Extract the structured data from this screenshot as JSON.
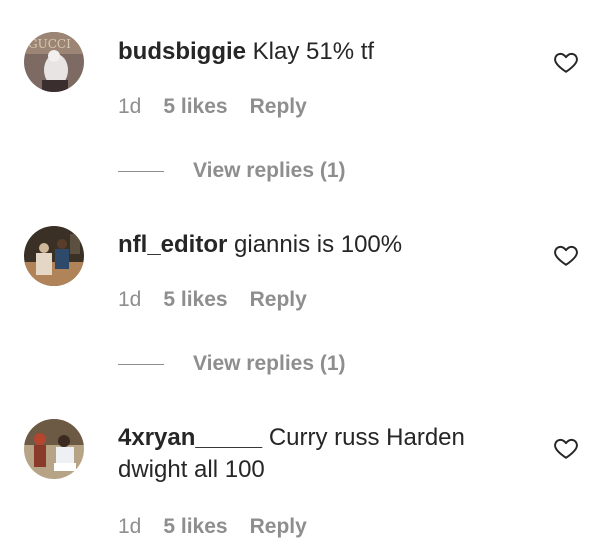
{
  "comments": [
    {
      "username": "budsbiggie",
      "text": "Klay 51% tf",
      "age": "1d",
      "likes": "5 likes",
      "reply": "Reply",
      "view_replies": "View replies (1)",
      "avatar_icon": "avatar-image",
      "like_icon": "heart-icon"
    },
    {
      "username": "nfl_editor",
      "text": "giannis is 100%",
      "age": "1d",
      "likes": "5 likes",
      "reply": "Reply",
      "view_replies": "View replies (1)",
      "avatar_icon": "avatar-image",
      "like_icon": "heart-icon"
    },
    {
      "username": "4xryan_____",
      "text": "Curry russ Harden dwight all 100",
      "age": "1d",
      "likes": "5 likes",
      "reply": "Reply",
      "avatar_icon": "avatar-image",
      "like_icon": "heart-icon"
    }
  ],
  "colors": {
    "text": "#262626",
    "muted": "#8e8e8e",
    "background": "#ffffff"
  }
}
